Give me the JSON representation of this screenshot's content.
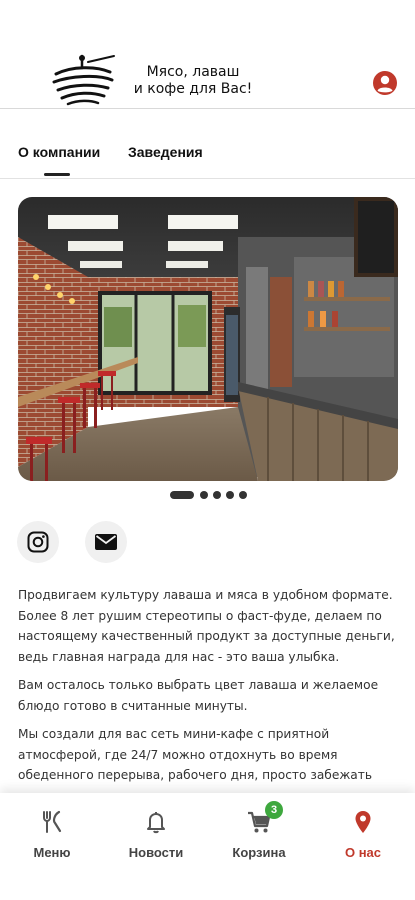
{
  "header": {
    "slogan_line1": "Мясо, лаваш",
    "slogan_line2": "и кофе для Вас!",
    "profile_icon": "account-circle-icon",
    "accent_color": "#c0392b"
  },
  "tabs": [
    {
      "label": "О компании",
      "active": true
    },
    {
      "label": "Заведения",
      "active": false
    }
  ],
  "gallery": {
    "slides_count": 5,
    "active_slide": 1
  },
  "social": [
    {
      "icon": "instagram-icon"
    },
    {
      "icon": "mail-icon"
    }
  ],
  "about": {
    "paragraphs": [
      "Продвигаем культуру лаваша и мяса в удобном формате. Более 8 лет рушим стереотипы о фаст-фуде, делаем по настоящему качественный продукт за доступные деньги, ведь главная награда для нас - это ваша улыбка.",
      "Вам осталось только выбрать цвет лаваша и желаемое блюдо готово в считанные минуты.",
      "Мы создали для вас сеть мини-кафе с приятной атмосферой, где 24/7 можно отдохнуть во время обеденного перерыва, рабочего дня, просто забежать"
    ]
  },
  "bottom_nav": [
    {
      "label": "Меню",
      "icon": "fork-knife-icon"
    },
    {
      "label": "Новости",
      "icon": "bell-icon"
    },
    {
      "label": "Корзина",
      "icon": "cart-icon",
      "badge": "3"
    },
    {
      "label": "О нас",
      "icon": "location-pin-icon",
      "active": true
    }
  ]
}
